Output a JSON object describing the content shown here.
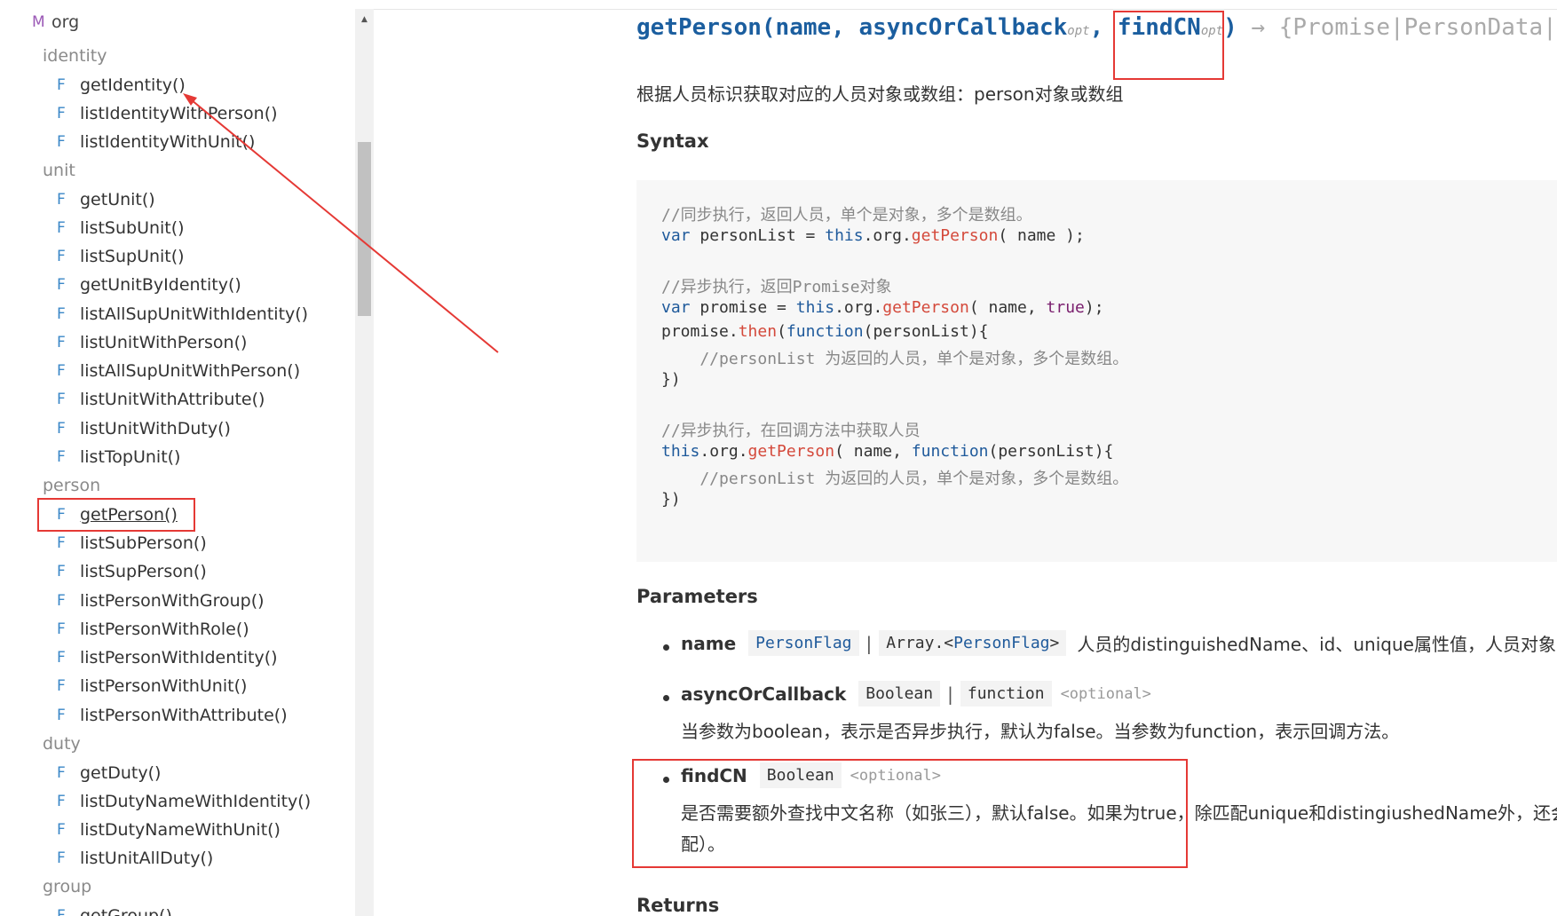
{
  "sidebar": {
    "module": {
      "kind": "M",
      "label": "org"
    },
    "groups": {
      "identity": "identity",
      "unit": "unit",
      "person": "person",
      "duty": "duty",
      "group": "group"
    },
    "items": {
      "getIdentity": "getIdentity()",
      "listIdentityWithPerson": "listIdentityWithPerson()",
      "listIdentityWithUnit": "listIdentityWithUnit()",
      "getUnit": "getUnit()",
      "listSubUnit": "listSubUnit()",
      "listSupUnit": "listSupUnit()",
      "getUnitByIdentity": "getUnitByIdentity()",
      "listAllSupUnitWithIdentity": "listAllSupUnitWithIdentity()",
      "listUnitWithPerson": "listUnitWithPerson()",
      "listAllSupUnitWithPerson": "listAllSupUnitWithPerson()",
      "listUnitWithAttribute": "listUnitWithAttribute()",
      "listUnitWithDuty": "listUnitWithDuty()",
      "listTopUnit": "listTopUnit()",
      "getPerson": "getPerson()",
      "listSubPerson": "listSubPerson()",
      "listSupPerson": "listSupPerson()",
      "listPersonWithGroup": "listPersonWithGroup()",
      "listPersonWithRole": "listPersonWithRole()",
      "listPersonWithIdentity": "listPersonWithIdentity()",
      "listPersonWithUnit": "listPersonWithUnit()",
      "listPersonWithAttribute": "listPersonWithAttribute()",
      "getDuty": "getDuty()",
      "listDutyNameWithIdentity": "listDutyNameWithIdentity()",
      "listDutyNameWithUnit": "listDutyNameWithUnit()",
      "listUnitAllDuty": "listUnitAllDuty()",
      "getGroup": "getGroup()"
    },
    "function_kind": "F",
    "selected_item": "getPerson()"
  },
  "signature": {
    "fn_name": "getPerson",
    "open": "(",
    "p1": "name",
    "comma": ", ",
    "p2": "asyncOrCallback",
    "opt": "opt",
    "p3": "findCN",
    "close": ")",
    "returns": " → {Promise|PersonData|"
  },
  "description": "根据人员标识获取对应的人员对象或数组：person对象或数组",
  "syntax": {
    "heading": "Syntax",
    "comment1": "//同步执行，返回人员，单个是对象，多个是数组。",
    "comment2": "//异步执行，返回Promise对象",
    "comment3": "    //personList 为返回的人员，单个是对象，多个是数组。",
    "comment4": "//异步执行，在回调方法中获取人员",
    "comment5": "    //personList 为返回的人员，单个是对象，多个是数组。",
    "close_brace": "})"
  },
  "parameters": {
    "heading": "Parameters",
    "name": {
      "label": "name",
      "type1": "PersonFlag",
      "sep": "|",
      "type2_prefix": "Array.<",
      "type2_link": "PersonFlag",
      "type2_suffix": ">",
      "desc": "人员的distinguishedName、id、unique属性值，人员对象，"
    },
    "asyncOrCallback": {
      "label": "asyncOrCallback",
      "type1": "Boolean",
      "sep": "|",
      "type2": "function",
      "optional": "<optional>",
      "desc": "当参数为boolean，表示是否异步执行，默认为false。当参数为function，表示回调方法。"
    },
    "findCN": {
      "label": "findCN",
      "type1": "Boolean",
      "optional": "<optional>",
      "desc_line1": "是否需要额外查找中文名称（如张三），默认false。如果为true，除匹配unique和distingiushedName外，还会",
      "desc_line2": "配）。"
    }
  },
  "returns": {
    "heading": "Returns"
  },
  "colors": {
    "annotation_red": "#e53935",
    "link_blue": "#1f5a9b",
    "method_red": "#d4493b",
    "code_bg": "#f7f7f7"
  }
}
